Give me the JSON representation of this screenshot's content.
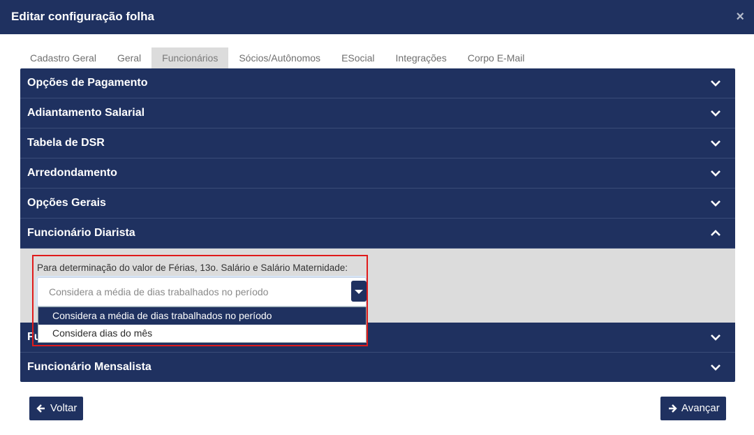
{
  "modal": {
    "title": "Editar configuração folha",
    "close": "×"
  },
  "tabs": [
    {
      "label": "Cadastro Geral"
    },
    {
      "label": "Geral"
    },
    {
      "label": "Funcionários"
    },
    {
      "label": "Sócios/Autônomos"
    },
    {
      "label": "ESocial"
    },
    {
      "label": "Integrações"
    },
    {
      "label": "Corpo E-Mail"
    }
  ],
  "active_tab": "Funcionários",
  "sections": [
    {
      "title": "Opções de Pagamento"
    },
    {
      "title": "Adiantamento Salarial"
    },
    {
      "title": "Tabela de DSR"
    },
    {
      "title": "Arredondamento"
    },
    {
      "title": "Opções Gerais"
    },
    {
      "title": "Funcionário Diarista"
    },
    {
      "title": "Fu"
    },
    {
      "title": "Funcionário Mensalista"
    }
  ],
  "expanded_section": "Funcionário Diarista",
  "diarista": {
    "label": "Para determinação do valor de Férias, 13o. Salário e Salário Maternidade:",
    "selected_value": "Considera a média de dias trabalhados no período",
    "options": [
      "Considera a média de dias trabalhados no período",
      "Considera dias do mês"
    ]
  },
  "buttons": {
    "back": "Voltar",
    "next": "Avançar"
  },
  "colors": {
    "header_bg": "#1f3160",
    "highlight": "#e01b1b"
  }
}
